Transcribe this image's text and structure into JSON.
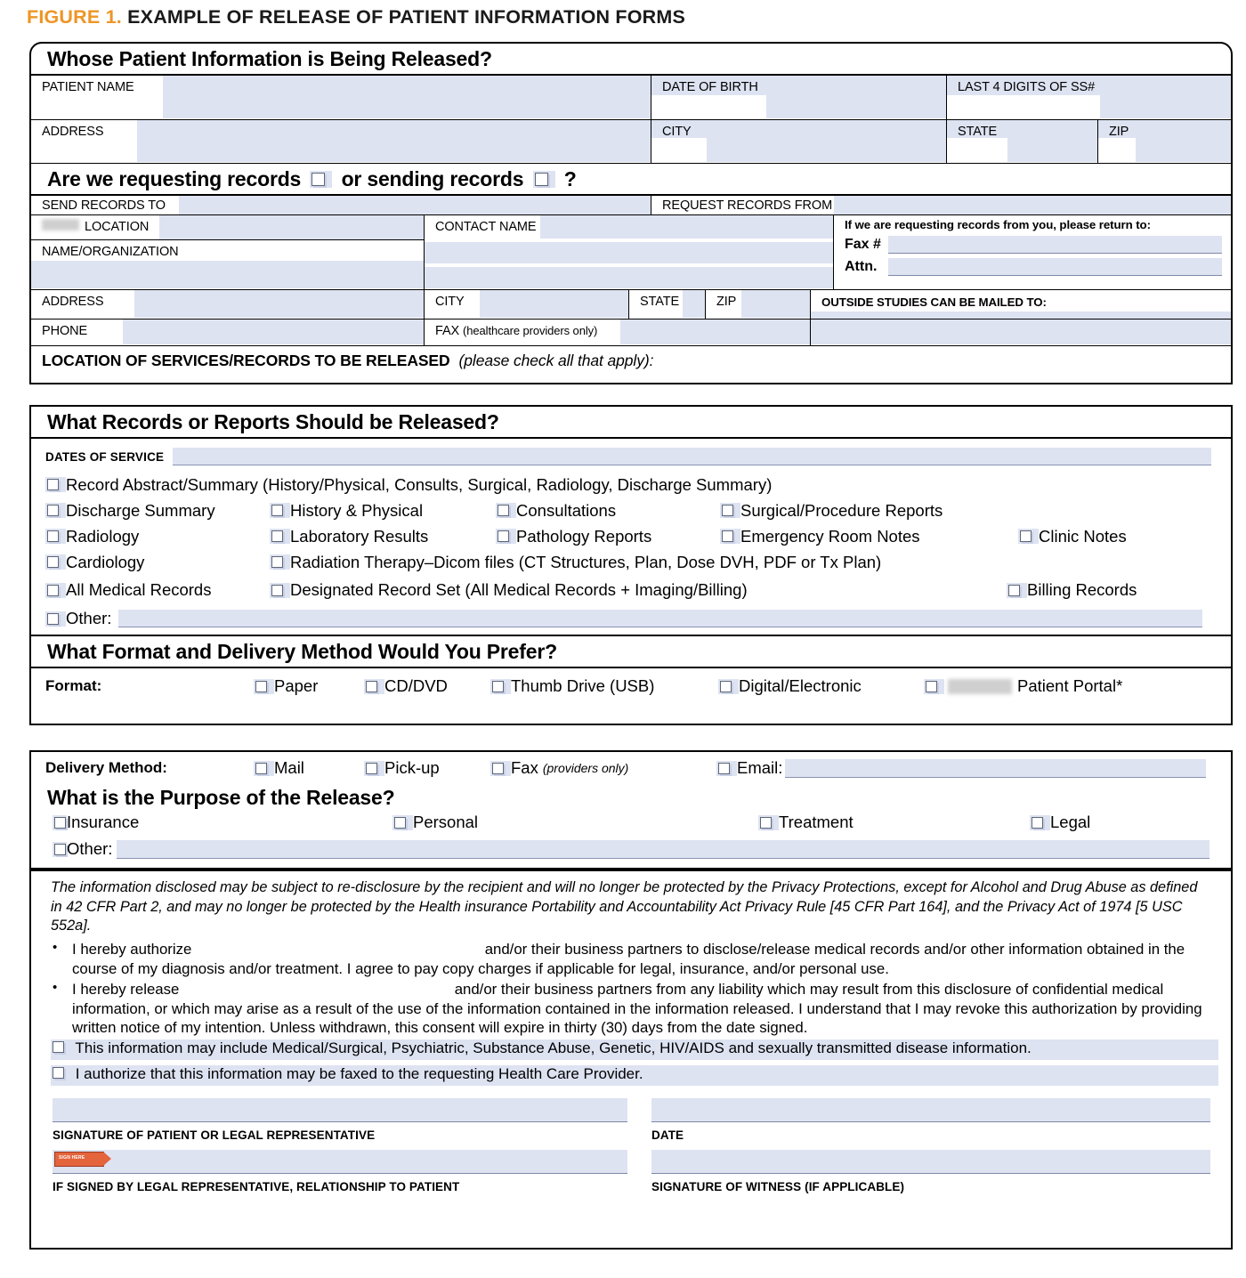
{
  "figure": {
    "number": "FIGURE 1.",
    "title": "EXAMPLE OF RELEASE OF PATIENT INFORMATION FORMS",
    "accent_color": "#EE9526",
    "field_fill_color": "#dee3f2"
  },
  "panel_patient": {
    "heading": "Whose Patient Information is Being Released?",
    "fields": {
      "patient_name": "PATIENT NAME",
      "date_of_birth": "DATE OF BIRTH",
      "last4_ssn": "LAST 4 DIGITS OF SS#",
      "address": "ADDRESS",
      "city": "CITY",
      "state": "STATE",
      "zip": "ZIP"
    }
  },
  "panel_direction": {
    "heading_part1": "Are we requesting records",
    "heading_part2": "or sending records",
    "heading_part3": "?",
    "send_records_to": "SEND RECORDS TO",
    "request_records_from": "REQUEST RECORDS FROM",
    "location": "LOCATION",
    "location_redacted": true,
    "contact_name": "CONTACT NAME",
    "name_organization": "NAME/ORGANIZATION",
    "return_note": "If we are requesting records from you, please return to:",
    "fax_label": "Fax #",
    "attn_label": "Attn.",
    "outside_studies": "OUTSIDE STUDIES CAN BE MAILED TO:",
    "address": "ADDRESS",
    "city": "CITY",
    "state": "STATE",
    "zip": "ZIP",
    "phone": "PHONE",
    "fax_providers": "FAX (healthcare providers only)",
    "fax_providers_main": "FAX ",
    "fax_providers_paren": "(healthcare providers only)",
    "location_of_services_bold": "LOCATION OF SERVICES/RECORDS  TO BE RELEASED",
    "location_of_services_italic": "(please check all that apply):"
  },
  "panel_records": {
    "heading": "What Records or Reports Should be Released?",
    "dates_of_service_label": "DATES OF SERVICE",
    "row1": [
      {
        "label": "Record Abstract/Summary  (History/Physical, Consults, Surgical, Radiology, Discharge Summary)",
        "checked": false
      }
    ],
    "row2": [
      {
        "label": "Discharge Summary",
        "checked": false
      },
      {
        "label": "History & Physical",
        "checked": false
      },
      {
        "label": "Consultations",
        "checked": false
      },
      {
        "label": "Surgical/Procedure Reports",
        "checked": false
      }
    ],
    "row3": [
      {
        "label": "Radiology",
        "checked": false
      },
      {
        "label": "Laboratory Results",
        "checked": false
      },
      {
        "label": "Pathology Reports",
        "checked": false
      },
      {
        "label": "Emergency Room Notes",
        "checked": false
      },
      {
        "label": "Clinic Notes",
        "checked": false
      }
    ],
    "row4": [
      {
        "label": "Cardiology",
        "checked": false
      },
      {
        "label": "Radiation Therapy–Dicom files (CT Structures, Plan, Dose DVH, PDF or Tx Plan)",
        "checked": false
      }
    ],
    "row5": [
      {
        "label": "All Medical Records",
        "checked": false
      },
      {
        "label": "Designated Record Set (All Medical Records + Imaging/Billing)",
        "checked": false
      },
      {
        "label": "Billing Records",
        "checked": false
      }
    ],
    "other_label": "Other:"
  },
  "panel_format": {
    "heading": "What Format and Delivery Method Would You Prefer?",
    "format_label": "Format:",
    "options": [
      {
        "label": "Paper",
        "checked": false
      },
      {
        "label": "CD/DVD",
        "checked": false
      },
      {
        "label": "Thumb Drive (USB)",
        "checked": false
      },
      {
        "label": "Digital/Electronic",
        "checked": false
      },
      {
        "label": "Patient Portal*",
        "checked": false,
        "redacted_prefix": true
      }
    ]
  },
  "panel_delivery": {
    "delivery_label": "Delivery Method:",
    "options": [
      {
        "label": "Mail",
        "checked": false
      },
      {
        "label": "Pick-up",
        "checked": false
      },
      {
        "label": "Fax",
        "note": "(providers only)",
        "checked": false
      },
      {
        "label": "Email:",
        "checked": false
      }
    ],
    "purpose_heading": "What is the Purpose of the Release?",
    "purpose_options": [
      {
        "label": "Insurance",
        "checked": false
      },
      {
        "label": "Personal",
        "checked": false
      },
      {
        "label": "Treatment",
        "checked": false
      },
      {
        "label": "Legal",
        "checked": false
      }
    ],
    "purpose_other": "Other:"
  },
  "panel_legal": {
    "disclosure": "The information disclosed may be subject to re-disclosure by the recipient and will no longer be protected by the Privacy Protections, except for Alcohol and Drug Abuse as defined in 42 CFR Part 2, and may no longer be protected by the Health insurance Portability and Accountability Act Privacy Rule [45 CFR Part 164], and the Privacy Act of 1974 [5 USC 552a].",
    "bullet1_pre": "I hereby authorize",
    "bullet1_post": "and/or their business partners to disclose/release medical records and/or other information obtained in the course of my diagnosis and/or treatment. I agree to pay copy charges if applicable for legal, insurance, and/or personal use.",
    "bullet2_pre": "I hereby release",
    "bullet2_post": "and/or their business partners from any liability which may result from this disclosure of confidential medical information, or which may arise as a result of the use of the information contained in the information released. I understand that I may revoke this authorization by providing written notice of my intention. Unless withdrawn, this consent will expire in thirty (30) days from the date signed.",
    "check1": "This information may include Medical/Surgical, Psychiatric, Substance Abuse, Genetic, HIV/AIDS and sexually transmitted disease information.",
    "check2": "I authorize that this information may be faxed to the requesting Health Care Provider.",
    "sig_patient": "SIGNATURE OF PATIENT OR LEGAL REPRESENTATIVE",
    "sig_date": "DATE",
    "sig_relationship": "IF SIGNED BY LEGAL REPRESENTATIVE, RELATIONSHIP TO PATIENT",
    "sig_witness": "SIGNATURE OF WITNESS (IF APPLICABLE)",
    "sign_tag_text": "SIGN HERE"
  }
}
